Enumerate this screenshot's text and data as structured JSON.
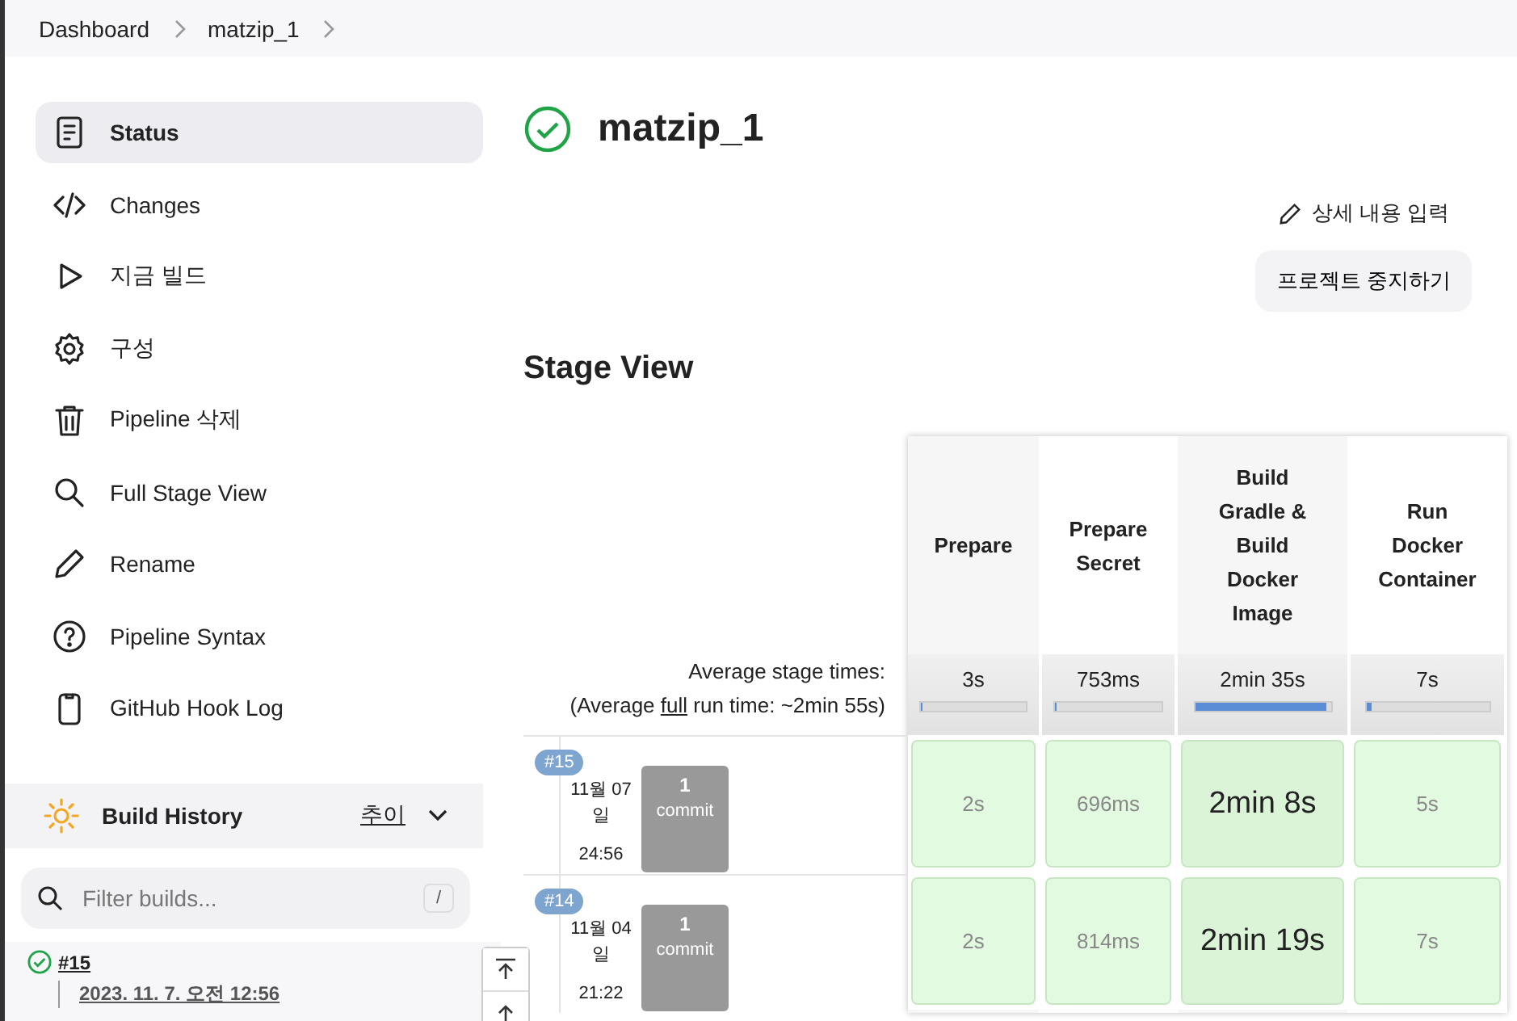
{
  "breadcrumbs": [
    "Dashboard",
    "matzip_1"
  ],
  "sidebar": {
    "items": [
      {
        "label": "Status",
        "selected": true
      },
      {
        "label": "Changes",
        "selected": false
      },
      {
        "label": "지금 빌드",
        "selected": false
      },
      {
        "label": "구성",
        "selected": false
      },
      {
        "label": "Pipeline 삭제",
        "selected": false
      },
      {
        "label": "Full Stage View",
        "selected": false
      },
      {
        "label": "Rename",
        "selected": false
      },
      {
        "label": "Pipeline Syntax",
        "selected": false
      },
      {
        "label": "GitHub Hook Log",
        "selected": false
      }
    ]
  },
  "build_history": {
    "title": "Build History",
    "trend_link": "추이",
    "filter": {
      "placeholder": "Filter builds...",
      "shortcut": "/"
    },
    "builds": [
      {
        "number": "#15",
        "date": "2023. 11. 7. 오전 12:56"
      }
    ]
  },
  "project": {
    "title": "matzip_1",
    "edit_description": "상세 내용 입력",
    "disable_button": "프로젝트 중지하기"
  },
  "stage_view": {
    "title": "Stage View",
    "average_label": "Average stage times:",
    "run_time_prefix": "(Average ",
    "run_time_link": "full",
    "run_time_suffix": " run time: ~2min 55s)",
    "stages": [
      {
        "name": "Prepare",
        "average": "3s",
        "level": 0.02
      },
      {
        "name": "Prepare Secret",
        "average": "753ms",
        "level": 0.01
      },
      {
        "name": "Build Gradle & Build Docker Image",
        "average": "2min 35s",
        "level": 0.97
      },
      {
        "name": "Run Docker Container",
        "average": "7s",
        "level": 0.04
      }
    ],
    "runs": [
      {
        "number": "#15",
        "date": "11월 07일",
        "time": "24:56",
        "commit_count": "1",
        "commit_label": "commit",
        "cells": [
          {
            "duration": "2s",
            "emphasized": false
          },
          {
            "duration": "696ms",
            "emphasized": false
          },
          {
            "duration": "2min 8s",
            "emphasized": true
          },
          {
            "duration": "5s",
            "emphasized": false
          }
        ]
      },
      {
        "number": "#14",
        "date": "11월 04일",
        "time": "21:22",
        "commit_count": "1",
        "commit_label": "commit",
        "cells": [
          {
            "duration": "2s",
            "emphasized": false
          },
          {
            "duration": "814ms",
            "emphasized": false
          },
          {
            "duration": "2min 19s",
            "emphasized": true
          },
          {
            "duration": "7s",
            "emphasized": false
          }
        ]
      }
    ]
  }
}
